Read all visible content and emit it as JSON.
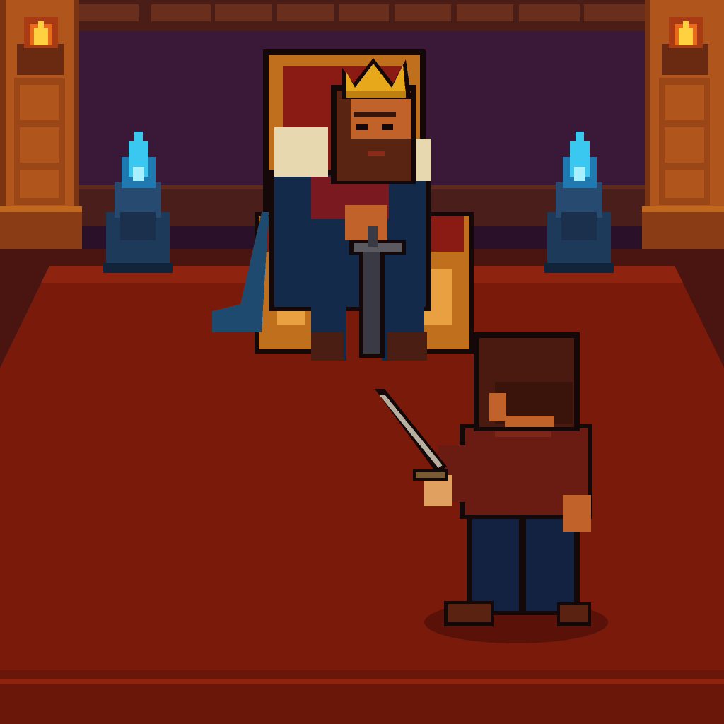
{
  "scene": {
    "name": "throne-room",
    "colors": {
      "wall": "#3a1838",
      "wall_dark": "#2a1028",
      "trim_wood": "#5a2a1c",
      "carpet": "#7a1a0a",
      "carpet_border": "#8e2410",
      "pillar_wood": "#b0561c",
      "pillar_dark": "#7a3412",
      "torch_flame": "#ffd040",
      "blue_flame": "#3ac8f0",
      "brazier": "#1e3a5a",
      "throne_wood": "#c0701c",
      "throne_red": "#8a1a14",
      "crown_gold": "#e8a81c",
      "king_robe": "#142a4a",
      "king_skin": "#c0622a",
      "fur": "#e8d8b0",
      "sword_blade": "#b8b0a0",
      "hero_shirt": "#6a1c12",
      "hero_pants": "#122240",
      "hero_hair": "#4a1a10",
      "outline": "#140808"
    },
    "icons": [
      "torch-icon",
      "blue-flame-icon",
      "crown-icon",
      "sword-icon"
    ]
  }
}
